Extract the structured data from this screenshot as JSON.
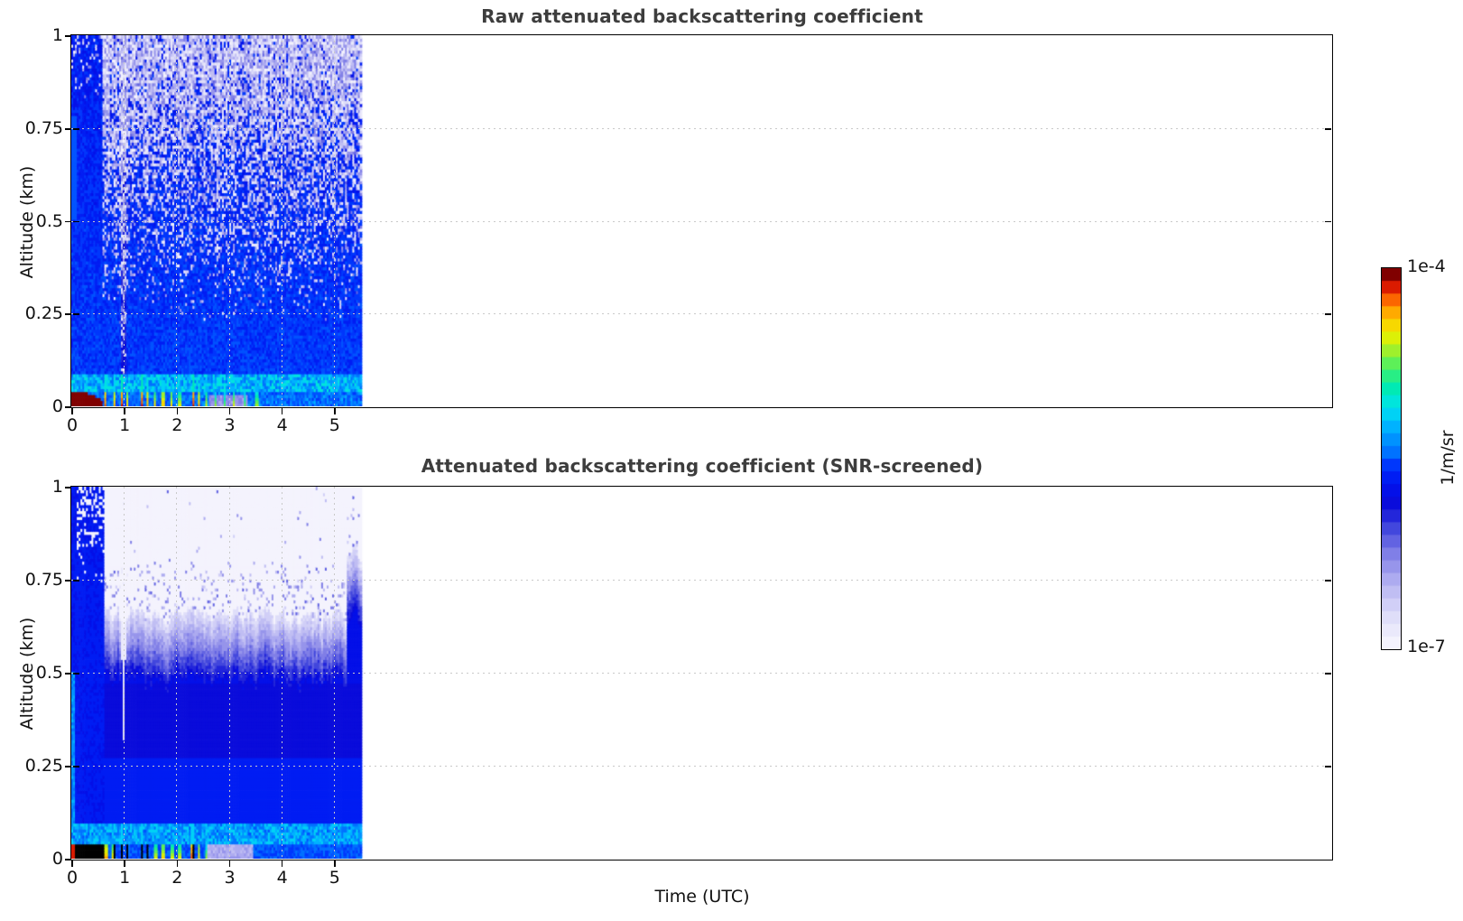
{
  "figure": {
    "bg": "#ffffff"
  },
  "colors": {
    "title": "#3d3d3d",
    "text": "#111111",
    "grid": "#c9c9c9",
    "spine": "#000000"
  },
  "top_plot": {
    "title": "Raw attenuated backscattering coefficient"
  },
  "bottom_plot": {
    "title": "Attenuated backscattering coefficient (SNR-screened)"
  },
  "axes": {
    "xlabel": "Time (UTC)",
    "ylabel": "Altitude (km)",
    "x_ticks": [
      0,
      1,
      2,
      3,
      4,
      5
    ],
    "x_tick_labels": [
      "0",
      "1",
      "2",
      "3",
      "4",
      "5"
    ],
    "y_ticks": [
      0,
      0.25,
      0.5,
      0.75,
      1
    ],
    "y_tick_labels": [
      "0",
      "0.25",
      "0.5",
      "0.75",
      "1"
    ],
    "xlim": [
      0,
      24
    ],
    "ylim": [
      0,
      1
    ],
    "grid": "dotted"
  },
  "colorbar": {
    "top_label": "1e-4",
    "bottom_label": "1e-7",
    "unit_label": "1/m/sr"
  },
  "colormap": {
    "n_steps": 30,
    "masked_color": "#000000",
    "stops": [
      [
        0.0,
        "#f4f3fd"
      ],
      [
        0.06,
        "#e2e1fa"
      ],
      [
        0.12,
        "#c8c6f5"
      ],
      [
        0.18,
        "#a5a3ee"
      ],
      [
        0.24,
        "#7b7ae6"
      ],
      [
        0.3,
        "#4247dd"
      ],
      [
        0.36,
        "#0b0bd8"
      ],
      [
        0.42,
        "#0013f0"
      ],
      [
        0.48,
        "#0041ff"
      ],
      [
        0.54,
        "#0078ff"
      ],
      [
        0.6,
        "#00b2ff"
      ],
      [
        0.65,
        "#00e2f0"
      ],
      [
        0.7,
        "#00eab4"
      ],
      [
        0.75,
        "#3cf06e"
      ],
      [
        0.8,
        "#9ff02c"
      ],
      [
        0.84,
        "#e8f000"
      ],
      [
        0.88,
        "#ffcc00"
      ],
      [
        0.92,
        "#ff8800"
      ],
      [
        0.95,
        "#f53c00"
      ],
      [
        0.98,
        "#c40000"
      ],
      [
        1.0,
        "#800000"
      ]
    ]
  },
  "chart_data": [
    {
      "type": "heatmap",
      "name": "raw_attenuated_backscatter",
      "title": "Raw attenuated backscattering coefficient",
      "x_label": "Time (UTC)",
      "y_label": "Altitude (km)",
      "x_lim": [
        0,
        24
      ],
      "y_lim": [
        0,
        1
      ],
      "x_data_extent": [
        0,
        5.5
      ],
      "value_min": "1e-7",
      "value_max": "1e-4",
      "value_unit": "1/m/sr",
      "value_scale": "log",
      "seed": 20,
      "features": {
        "surface_strong_layer": {
          "t_end": 0.58,
          "z_top": 0.055,
          "level": 0.99
        },
        "surface_background_level": 0.47,
        "cyan_band": {
          "z": [
            0.034,
            0.088
          ],
          "level": 0.6
        },
        "noise_start_z": 0.22,
        "dense_column_t_end": 0.58,
        "light_streak_t": 0.98,
        "lavender_patch": {
          "t": [
            2.62,
            3.34
          ],
          "z_top": 0.03,
          "level": 0.17
        },
        "spikes": [
          {
            "t": 0.63,
            "h": 0.1,
            "v": 0.93
          },
          {
            "t": 0.8,
            "h": 0.07,
            "v": 0.89
          },
          {
            "t": 0.95,
            "h": 0.12,
            "v": 0.95
          },
          {
            "t": 1.05,
            "h": 0.06,
            "v": 0.87
          },
          {
            "t": 1.33,
            "h": 0.13,
            "v": 0.95
          },
          {
            "t": 1.43,
            "h": 0.08,
            "v": 0.9
          },
          {
            "t": 1.58,
            "h": 0.05,
            "v": 0.85
          },
          {
            "t": 1.73,
            "h": 0.07,
            "v": 0.88
          },
          {
            "t": 1.9,
            "h": 0.06,
            "v": 0.86
          },
          {
            "t": 2.05,
            "h": 0.05,
            "v": 0.84
          },
          {
            "t": 2.3,
            "h": 0.14,
            "v": 0.95
          },
          {
            "t": 2.42,
            "h": 0.06,
            "v": 0.9
          },
          {
            "t": 2.56,
            "h": 0.05,
            "v": 0.82
          },
          {
            "t": 2.72,
            "h": 0.04,
            "v": 0.8
          },
          {
            "t": 2.9,
            "h": 0.04,
            "v": 0.78
          },
          {
            "t": 3.07,
            "h": 0.05,
            "v": 0.82
          },
          {
            "t": 3.3,
            "h": 0.04,
            "v": 0.78
          },
          {
            "t": 3.52,
            "h": 0.05,
            "v": 0.8
          }
        ]
      }
    },
    {
      "type": "heatmap",
      "name": "attenuated_backscatter_snr_screened",
      "title": "Attenuated backscattering coefficient (SNR-screened)",
      "x_label": "Time (UTC)",
      "y_label": "Altitude (km)",
      "x_lim": [
        0,
        24
      ],
      "y_lim": [
        0,
        1
      ],
      "x_data_extent": [
        0,
        5.5
      ],
      "value_min": "1e-7",
      "value_max": "1e-4",
      "value_unit": "1/m/sr",
      "value_scale": "log",
      "seed": 77,
      "features": {
        "surface_darkred_t_end": 0.07,
        "surface_black_mask_t": [
          0.07,
          0.62
        ],
        "surface_background_level": 0.45,
        "cyan_band": {
          "z": [
            0.036,
            0.09
          ],
          "level": 0.58
        },
        "dense_column_t_end": 0.6,
        "column_hole_z_start": 0.74,
        "cloud": {
          "white_top_base": 0.6,
          "white_top_var": 0.1,
          "transition_depth": 0.18,
          "right_edge_boost": {
            "t_start": 5.25,
            "amount": 0.16
          }
        },
        "dark_band_z": [
          0.27,
          0.47
        ],
        "gap_funnel": {
          "t": 0.98,
          "z_start": 0.42
        },
        "lavender_patch": {
          "t": [
            2.55,
            3.45
          ],
          "z_top": 0.05,
          "level": 0.14
        },
        "spikes": [
          {
            "t": 0.66,
            "h": 0.06,
            "v": 0.9,
            "black": false
          },
          {
            "t": 0.8,
            "h": 0.05,
            "v": 0.85,
            "black": true
          },
          {
            "t": 0.95,
            "h": 0.1,
            "v": 0.92,
            "black": true
          },
          {
            "t": 1.05,
            "h": 0.05,
            "v": 0.85,
            "black": true
          },
          {
            "t": 1.33,
            "h": 0.12,
            "v": 0.93,
            "black": true
          },
          {
            "t": 1.43,
            "h": 0.07,
            "v": 0.88,
            "black": true
          },
          {
            "t": 1.58,
            "h": 0.05,
            "v": 0.84,
            "black": false
          },
          {
            "t": 1.73,
            "h": 0.06,
            "v": 0.86,
            "black": true
          },
          {
            "t": 1.9,
            "h": 0.05,
            "v": 0.84,
            "black": false
          },
          {
            "t": 2.05,
            "h": 0.05,
            "v": 0.83,
            "black": true
          },
          {
            "t": 2.3,
            "h": 0.13,
            "v": 0.93,
            "black": true
          },
          {
            "t": 2.42,
            "h": 0.05,
            "v": 0.88,
            "black": false
          },
          {
            "t": 2.56,
            "h": 0.04,
            "v": 0.8,
            "black": false
          }
        ]
      }
    }
  ]
}
